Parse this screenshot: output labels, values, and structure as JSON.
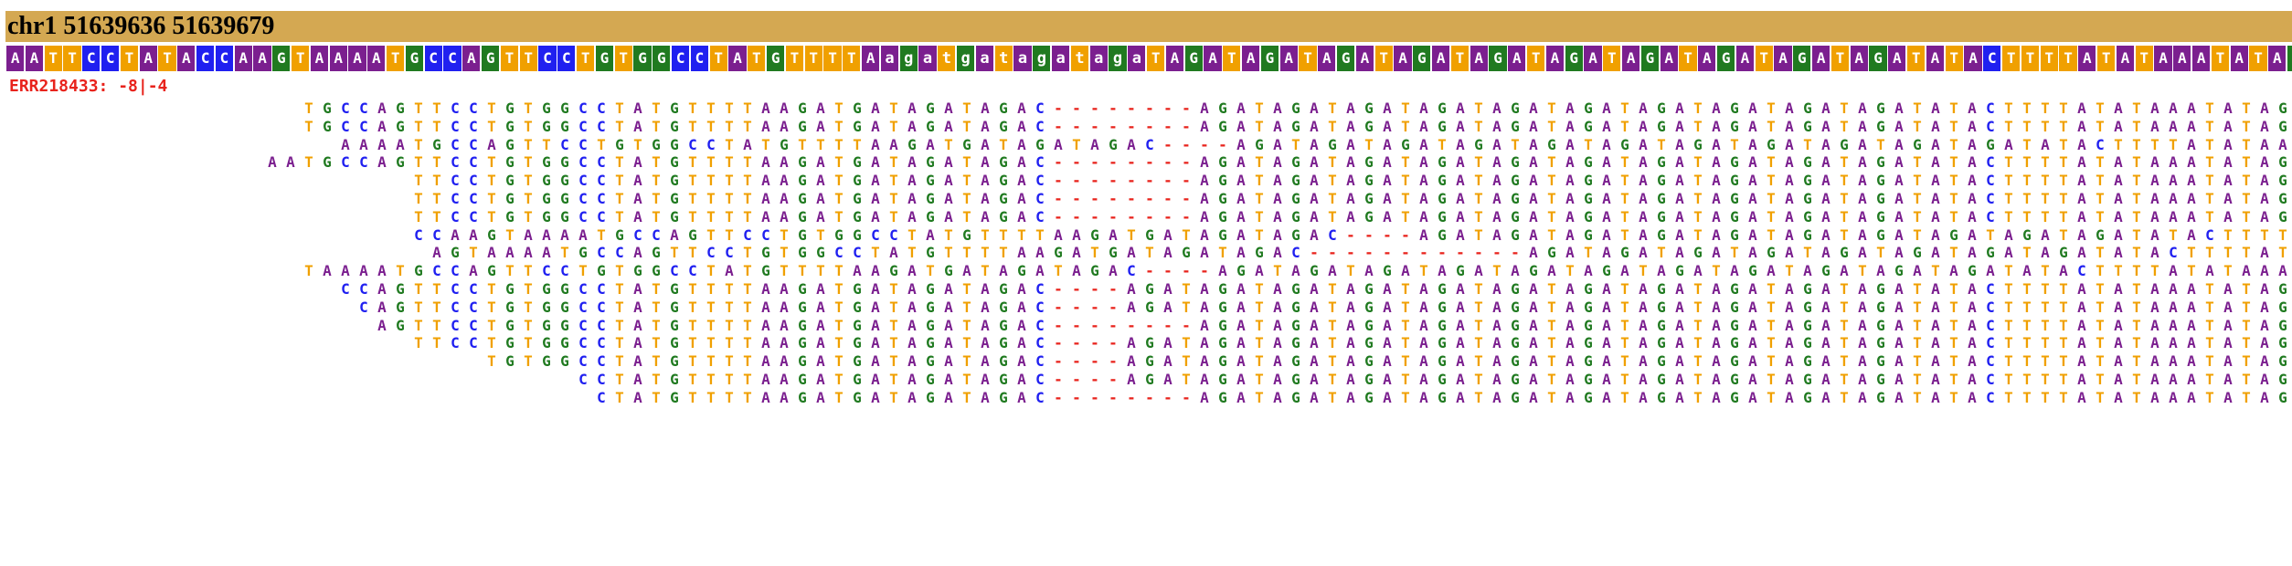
{
  "header": {
    "title": "chr1 51639636 51639679"
  },
  "sample": {
    "label": "ERR218433: -8|-4"
  },
  "colors": {
    "A": "#7b1f8f",
    "C": "#2020f0",
    "G": "#207a20",
    "T": "#f0a000",
    "gap": "#e8231c",
    "title_bg": "#d4a852"
  },
  "reference": "AATTCCTATACCAAGTAAAATGCCAGTTCCTGTGGCCTATGTTTTAagatgatagatagaTAGATAGATAGATAGATAGATAGATAGATAGATAGATAGATATACTTTTATATAAATATAG",
  "reads": [
    "TGCCAGTTCCTGTGGCCTATGTTTTAAGATGATAGATAGAC--------AGATAGATAGATAGATAGATAGATAGATAGATAGATAGATATACTTTTATATAAATATAG",
    "TGCCAGTTCCTGTGGCCTATGTTTTAAGATGATAGATAGAC--------AGATAGATAGATAGATAGATAGATAGATAGATAGATAGATATACTTTTATATAAATATAG",
    "AAAATGCCAGTTCCTGTGGCCTATGTTTTAAGATGATAGATAGAC----AGATAGATAGATAGATAGATAGATAGATAGATAGATAGATAGATATACTTTTATATAA",
    "AATGCCAGTTCCTGTGGCCTATGTTTTAAGATGATAGATAGAC--------AGATAGATAGATAGATAGATAGATAGATAGATAGATAGATATACTTTTATATAAATATAG",
    "TTCCTGTGGCCTATGTTTTAAGATGATAGATAGAC--------AGATAGATAGATAGATAGATAGATAGATAGATAGATAGATATACTTTTATATAAATATAG",
    "TTCCTGTGGCCTATGTTTTAAGATGATAGATAGAC--------AGATAGATAGATAGATAGATAGATAGATAGATAGATAGATATACTTTTATATAAATATAG",
    "TTCCTGTGGCCTATGTTTTAAGATGATAGATAGAC--------AGATAGATAGATAGATAGATAGATAGATAGATAGATAGATATACTTTTATATAAATATAG",
    "CCAAGTAAAATGCCAGTTCCTGTGGCCTATGTTTTAAGATGATAGATAGAC----AGATAGATAGATAGATAGATAGATAGATAGATAGATAGATATACTTTT",
    "AGTAAAATGCCAGTTCCTGTGGCCTATGTTTTAAGATGATAGATAGAC------------AGATAGATAGATAGATAGATAGATAGATAGATATACTTTTAT",
    "TAAAATGCCAGTTCCTGTGGCCTATGTTTTAAGATGATAGATAGAC----AGATAGATAGATAGATAGATAGATAGATAGATAGATAGATAGATATACTTTTATATAAA",
    "CCAGTTCCTGTGGCCTATGTTTTAAGATGATAGATAGAC----AGATAGATAGATAGATAGATAGATAGATAGATAGATAGATAGATATACTTTTATATAAATATAG",
    "CAGTTCCTGTGGCCTATGTTTTAAGATGATAGATAGAC----AGATAGATAGATAGATAGATAGATAGATAGATAGATAGATAGATATACTTTTATATAAATATAG",
    "AGTTCCTGTGGCCTATGTTTTAAGATGATAGATAGAC--------AGATAGATAGATAGATAGATAGATAGATAGATAGATAGATATACTTTTATATAAATATAG",
    "TTCCTGTGGCCTATGTTTTAAGATGATAGATAGAC----AGATAGATAGATAGATAGATAGATAGATAGATAGATAGATAGATATACTTTTATATAAATATAG",
    "TGTGGCCTATGTTTTAAGATGATAGATAGAC----AGATAGATAGATAGATAGATAGATAGATAGATAGATAGATAGATATACTTTTATATAAATATAG",
    "CCTATGTTTTAAGATGATAGATAGAC----AGATAGATAGATAGATAGATAGATAGATAGATAGATAGATAGATATACTTTTATATAAATATAG",
    "CTATGTTTTAAGATGATAGATAGAC--------AGATAGATAGATAGATAGATAGATAGATAGATAGATAGATATACTTTTATATAAATATAG"
  ]
}
